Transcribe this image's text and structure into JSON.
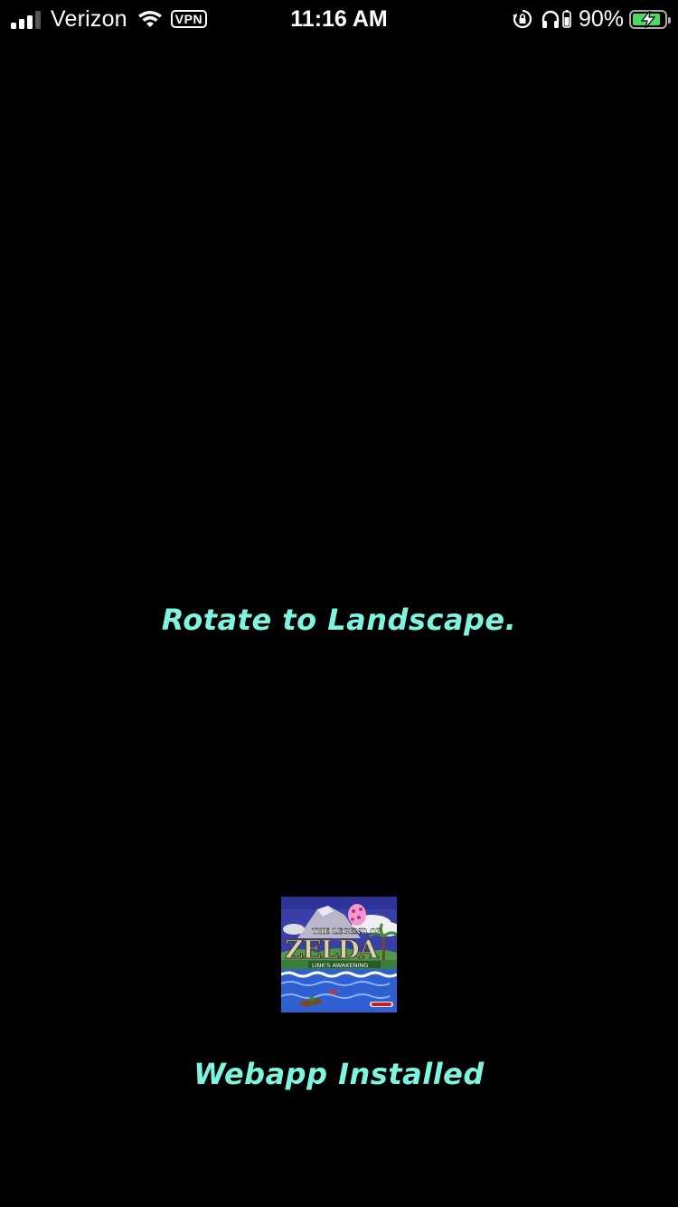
{
  "status_bar": {
    "carrier": "Verizon",
    "vpn_label": "VPN",
    "time": "11:16 AM",
    "battery_percent_label": "90%",
    "battery_level": 0.9,
    "signal_bars_active": 3,
    "signal_bars_total": 4,
    "icons": [
      "signal-icon",
      "wifi-icon",
      "vpn-badge",
      "rotation-lock-icon",
      "headphones-icon",
      "battery-icon",
      "charging-bolt-icon"
    ]
  },
  "main": {
    "rotate_message": "Rotate to Landscape.",
    "installed_message": "Webapp Installed",
    "app_icon": {
      "title_line1": "THE LEGEND OF",
      "title_main": "ZELDA",
      "subtitle": "LINK'S AWAKENING"
    }
  },
  "colors": {
    "background": "#000000",
    "message_text": "#7ff5e0",
    "status_text": "#ffffff",
    "battery_fill": "#4cd964"
  }
}
